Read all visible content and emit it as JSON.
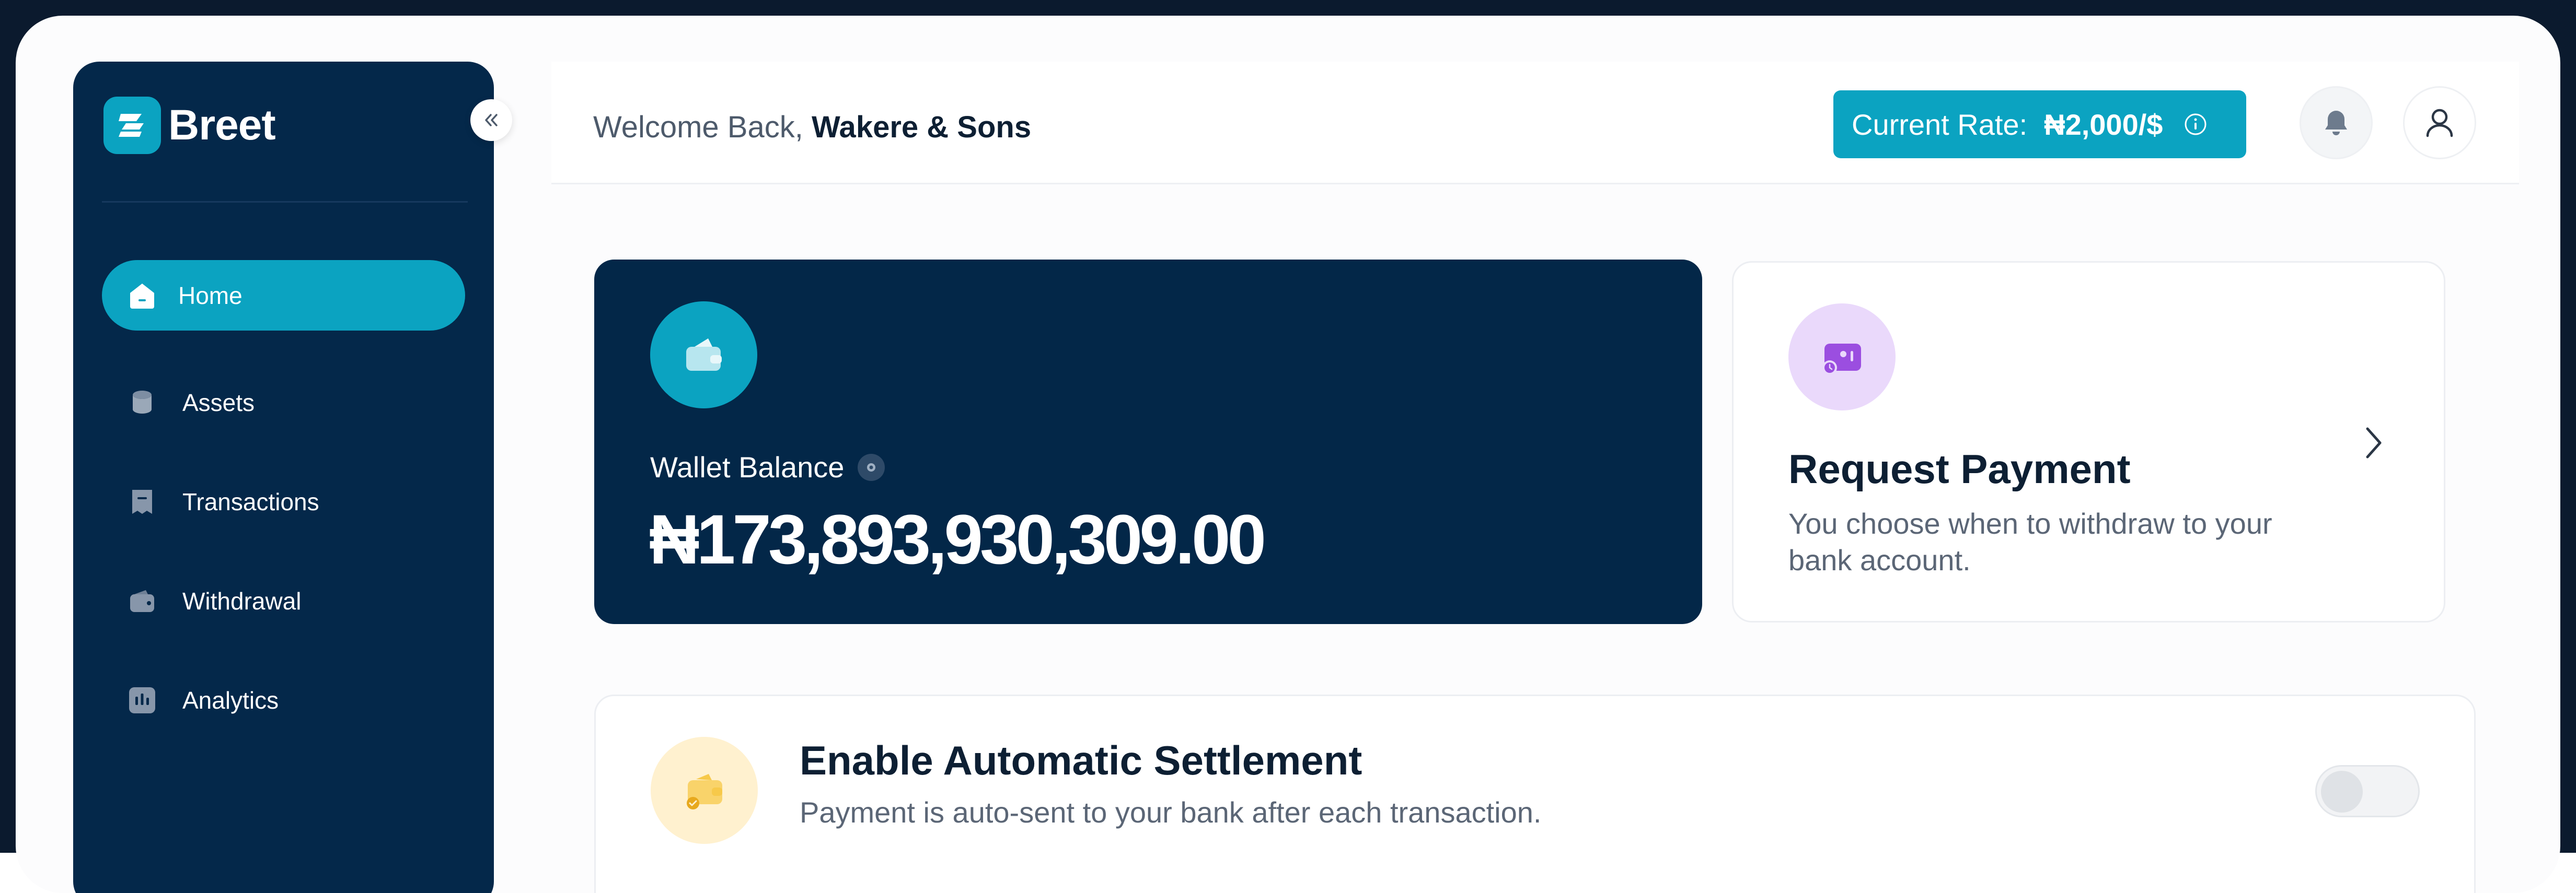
{
  "brand": {
    "name": "Breet",
    "accent_color": "#0BA3C1",
    "sidebar_color": "#04284A"
  },
  "sidebar": {
    "collapse_icon": "double-chevron-left-icon",
    "items": [
      {
        "label": "Home",
        "icon": "home-icon",
        "active": true
      },
      {
        "label": "Assets",
        "icon": "coins-icon",
        "active": false
      },
      {
        "label": "Transactions",
        "icon": "receipt-icon",
        "active": false
      },
      {
        "label": "Withdrawal",
        "icon": "wallet-icon",
        "active": false
      },
      {
        "label": "Analytics",
        "icon": "chart-icon",
        "active": false
      }
    ]
  },
  "header": {
    "welcome_prefix": "Welcome Back,",
    "user_name": "Wakere & Sons",
    "rate_label": "Current Rate:",
    "rate_value": "₦2,000/$",
    "rate_info_icon": "info-icon",
    "notification_icon": "bell-icon",
    "profile_icon": "user-icon"
  },
  "wallet": {
    "label": "Wallet Balance",
    "amount": "₦173,893,930,309.00",
    "icon": "wallet-icon",
    "visibility_icon": "eye-icon"
  },
  "request_payment": {
    "title": "Request Payment",
    "description": "You choose when to withdraw to your bank account.",
    "icon": "payment-request-icon",
    "chevron_icon": "chevron-right-icon"
  },
  "settlement": {
    "title": "Enable Automatic Settlement",
    "description": "Payment is auto-sent to your bank after each transaction.",
    "icon": "wallet-check-icon",
    "enabled": false
  }
}
